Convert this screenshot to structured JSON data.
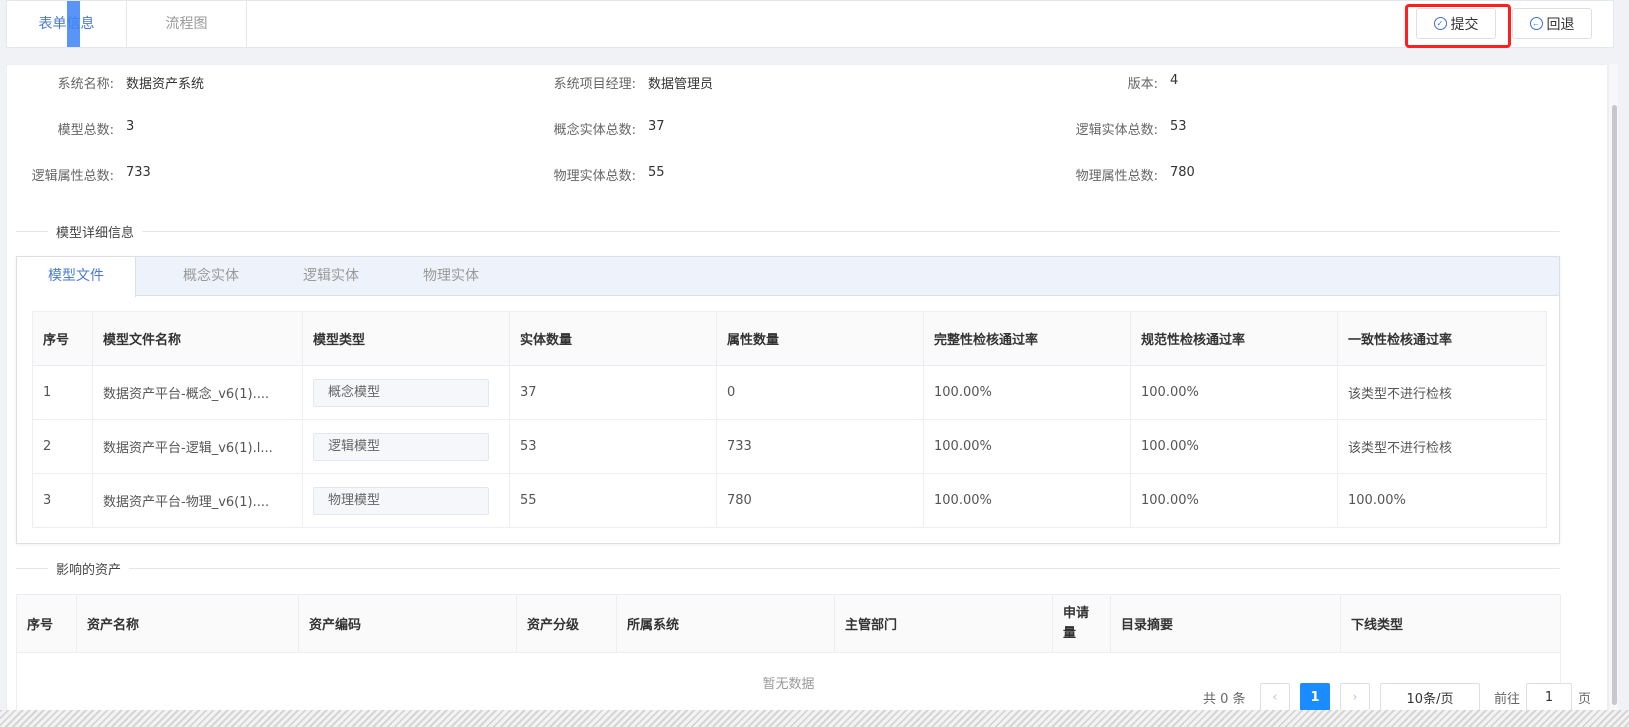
{
  "tabs": [
    {
      "label": "表单信息",
      "active": true
    },
    {
      "label": "流程图",
      "active": false
    }
  ],
  "actions": {
    "submit_label": "提交",
    "back_label": "回退"
  },
  "summary": {
    "system_name": {
      "label": "系统名称:",
      "value": "数据资产系统"
    },
    "manager": {
      "label": "系统项目经理:",
      "value": "数据管理员"
    },
    "version": {
      "label": "版本:",
      "value": "4"
    },
    "model_total": {
      "label": "模型总数:",
      "value": "3"
    },
    "concept_total": {
      "label": "概念实体总数:",
      "value": "37"
    },
    "logic_total": {
      "label": "逻辑实体总数:",
      "value": "53"
    },
    "logic_attr_total": {
      "label": "逻辑属性总数:",
      "value": "733"
    },
    "physical_total": {
      "label": "物理实体总数:",
      "value": "55"
    },
    "physical_attr_total": {
      "label": "物理属性总数:",
      "value": "780"
    }
  },
  "model_section": {
    "title": "模型详细信息",
    "tabs": [
      "模型文件",
      "概念实体",
      "逻辑实体",
      "物理实体"
    ],
    "columns": [
      "序号",
      "模型文件名称",
      "模型类型",
      "实体数量",
      "属性数量",
      "完整性检核通过率",
      "规范性检核通过率",
      "一致性检核通过率"
    ],
    "rows": [
      {
        "no": "1",
        "name": "数据资产平台-概念_v6(1)....",
        "type": "概念模型",
        "entities": "37",
        "attrs": "0",
        "integrity": "100.00%",
        "standard": "100.00%",
        "consistency": "该类型不进行检核"
      },
      {
        "no": "2",
        "name": "数据资产平台-逻辑_v6(1).l...",
        "type": "逻辑模型",
        "entities": "53",
        "attrs": "733",
        "integrity": "100.00%",
        "standard": "100.00%",
        "consistency": "该类型不进行检核"
      },
      {
        "no": "3",
        "name": "数据资产平台-物理_v6(1)....",
        "type": "物理模型",
        "entities": "55",
        "attrs": "780",
        "integrity": "100.00%",
        "standard": "100.00%",
        "consistency": "100.00%"
      }
    ]
  },
  "asset_section": {
    "title": "影响的资产",
    "columns": [
      "序号",
      "资产名称",
      "资产编码",
      "资产分级",
      "所属系统",
      "主管部门",
      "申请量",
      "目录摘要",
      "下线类型"
    ],
    "empty_text": "暂无数据"
  },
  "pagination": {
    "total_text": "共 0 条",
    "current_page": "1",
    "page_size": "10条/页",
    "goto_prefix": "前往",
    "goto_value": "1",
    "goto_suffix": "页"
  }
}
